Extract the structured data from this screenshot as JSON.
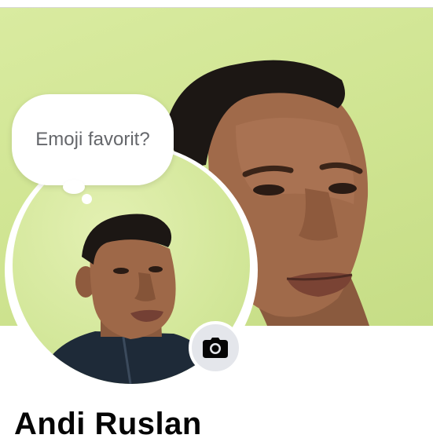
{
  "profile": {
    "name": "Andi Ruslan",
    "note_prompt": "Emoji favorit?"
  },
  "icons": {
    "camera": "camera-icon"
  },
  "colors": {
    "cover_background": "#cfe491",
    "camera_button": "#e4e6eb",
    "name_text": "#050505",
    "note_text": "#65676b"
  }
}
